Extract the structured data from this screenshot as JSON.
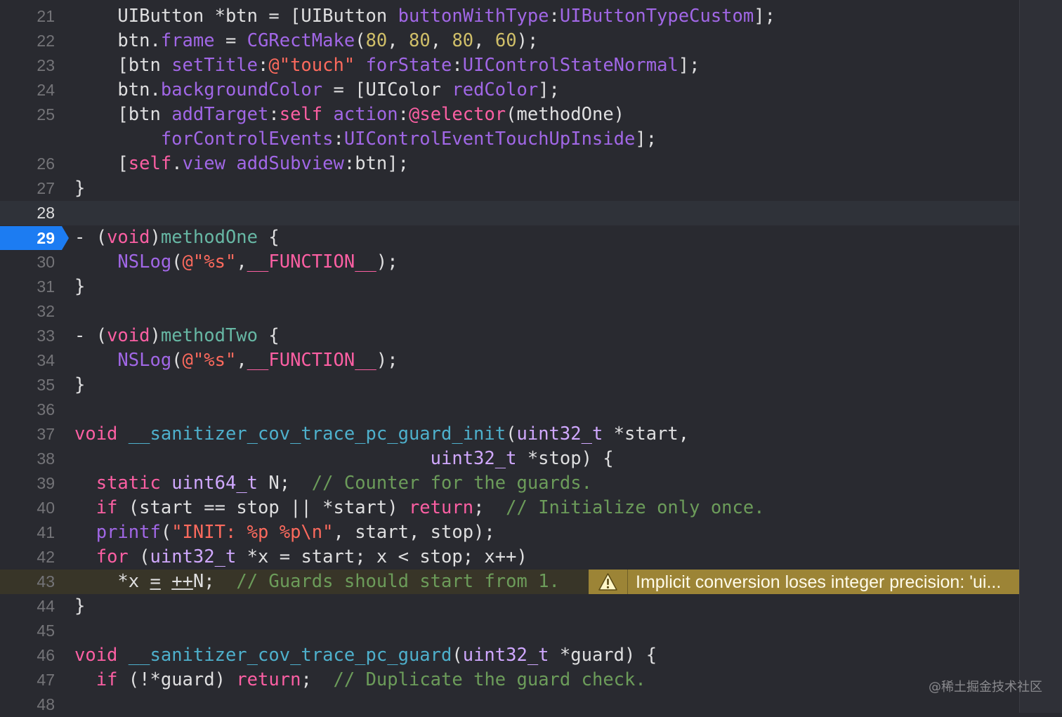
{
  "gutter": {
    "line_numbers": [
      "21",
      "22",
      "23",
      "24",
      "25",
      "26",
      "27",
      "28",
      "29",
      "30",
      "31",
      "32",
      "33",
      "34",
      "35",
      "36",
      "37",
      "38",
      "39",
      "40",
      "41",
      "42",
      "43",
      "44",
      "45",
      "46",
      "47",
      "48"
    ]
  },
  "breakpoint": {
    "line": "29",
    "color": "#1c7cf2"
  },
  "code": {
    "l21": [
      "UIButton *btn = [UIButton ",
      "buttonWithType",
      ":",
      "UIButtonTypeCustom",
      "];"
    ],
    "l22": [
      "btn.",
      "frame",
      " = ",
      "CGRectMake",
      "(",
      "80",
      ", ",
      "80",
      ", ",
      "80",
      ", ",
      "60",
      ");"
    ],
    "l23": [
      "[btn ",
      "setTitle",
      ":",
      "@\"touch\"",
      " ",
      "forState",
      ":",
      "UIControlStateNormal",
      "];"
    ],
    "l24": [
      "btn.",
      "backgroundColor",
      " = [UIColor ",
      "redColor",
      "];"
    ],
    "l25a": [
      "[btn ",
      "addTarget",
      ":",
      "self",
      " ",
      "action",
      ":",
      "@selector",
      "(methodOne)"
    ],
    "l25b": [
      "forControlEvents",
      ":",
      "UIControlEventTouchUpInside",
      "];"
    ],
    "l26": [
      "[",
      "self",
      ".",
      "view",
      " ",
      "addSubview",
      ":btn];"
    ],
    "l27": [
      "}"
    ],
    "l29": [
      "- (",
      "void",
      ")",
      "methodOne",
      " {"
    ],
    "l30": [
      "NSLog",
      "(",
      "@\"%s\"",
      ",",
      "__FUNCTION__",
      ");"
    ],
    "l31": [
      "}"
    ],
    "l33": [
      "- (",
      "void",
      ")",
      "methodTwo",
      " {"
    ],
    "l34": [
      "NSLog",
      "(",
      "@\"%s\"",
      ",",
      "__FUNCTION__",
      ");"
    ],
    "l35": [
      "}"
    ],
    "l37": [
      "void",
      " ",
      "__sanitizer_cov_trace_pc_guard_init",
      "(",
      "uint32_t",
      " *start,"
    ],
    "l38": [
      "uint32_t",
      " *stop) {"
    ],
    "l39": [
      "static",
      " ",
      "uint64_t",
      " N;  ",
      "// Counter for the guards."
    ],
    "l40": [
      "if",
      " (start == stop || *start) ",
      "return",
      ";  ",
      "// Initialize only once."
    ],
    "l41": [
      "printf",
      "(",
      "\"INIT: %p %p\\n\"",
      ", start, stop);"
    ],
    "l42": [
      "for",
      " (",
      "uint32_t",
      " *x = start; x < stop; x++)"
    ],
    "l43": [
      "*x ",
      "=",
      " ",
      "++",
      "N;  ",
      "// Guards should start from 1."
    ],
    "l44": [
      "}"
    ],
    "l46": [
      "void",
      " ",
      "__sanitizer_cov_trace_pc_guard",
      "(",
      "uint32_t",
      " *guard) {"
    ],
    "l47": [
      "if",
      " (!*guard) ",
      "return",
      ";  ",
      "// Duplicate the guard check."
    ]
  },
  "warning": {
    "icon": "warning-triangle-icon",
    "message": "Implicit conversion loses integer precision: 'ui..."
  },
  "watermark": "@稀土掘金技术社区",
  "colors": {
    "background": "#292a30",
    "keyword": "#fc5fa3",
    "type": "#d0a8ff",
    "method": "#a167e6",
    "project_function": "#67b7a4",
    "number": "#d0bf69",
    "string": "#fc6a5d",
    "comment": "#6c9c5a",
    "warning_banner": "#9c8436"
  }
}
